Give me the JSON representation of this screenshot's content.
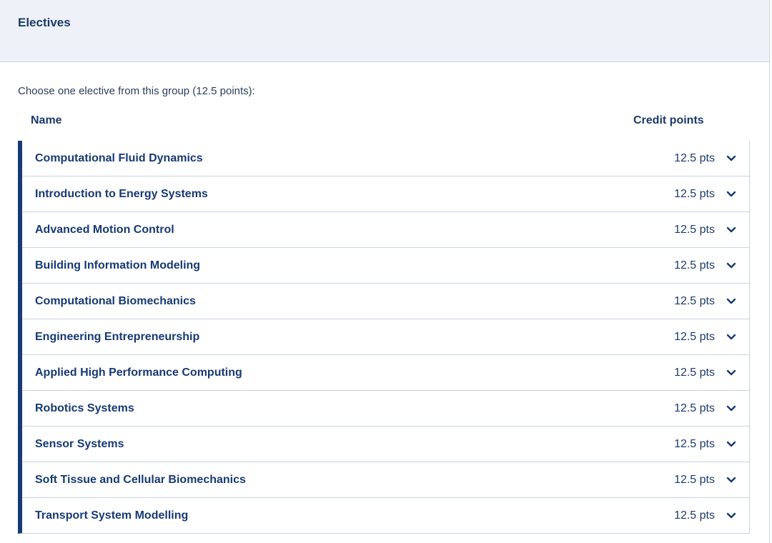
{
  "header": {
    "title": "Electives"
  },
  "intro": "Choose one elective from this group (12.5 points):",
  "columns": {
    "name": "Name",
    "credit_points": "Credit points"
  },
  "colors": {
    "accent": "#173a73",
    "header_bg": "#eef2f8",
    "border": "#c9d3e0"
  },
  "electives": [
    {
      "name": "Computational Fluid Dynamics",
      "points": "12.5 pts"
    },
    {
      "name": "Introduction to Energy Systems",
      "points": "12.5 pts"
    },
    {
      "name": "Advanced Motion Control",
      "points": "12.5 pts"
    },
    {
      "name": "Building Information Modeling",
      "points": "12.5 pts"
    },
    {
      "name": "Computational Biomechanics",
      "points": "12.5 pts"
    },
    {
      "name": "Engineering Entrepreneurship",
      "points": "12.5 pts"
    },
    {
      "name": "Applied High Performance Computing",
      "points": "12.5 pts"
    },
    {
      "name": "Robotics Systems",
      "points": "12.5 pts"
    },
    {
      "name": "Sensor Systems",
      "points": "12.5 pts"
    },
    {
      "name": "Soft Tissue and Cellular Biomechanics",
      "points": "12.5 pts"
    },
    {
      "name": "Transport System Modelling",
      "points": "12.5 pts"
    }
  ],
  "row_icon": "chevron-down-icon"
}
